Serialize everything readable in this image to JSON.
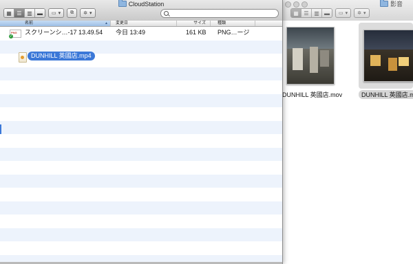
{
  "left_window": {
    "title": "CloudStation",
    "search": {
      "value": "",
      "placeholder": ""
    },
    "columns": {
      "name": "名前",
      "date": "変更日",
      "size": "サイズ",
      "kind": "種類"
    },
    "files": [
      {
        "name": "スクリーンシ…‐17 13.49.54",
        "date": "今日 13:49",
        "size": "161 KB",
        "kind": "PNG…ージ",
        "icon": "png-file-icon",
        "sync_status": "synced"
      },
      {
        "name": "DUNHILL 英國店.mp4",
        "date": "",
        "size": "",
        "kind": "",
        "icon": "mp4-file-icon",
        "selected": true
      }
    ]
  },
  "right_window": {
    "title": "影音",
    "items": [
      {
        "caption": "DUNHILL 英國店.mov",
        "caption_visible": "DUNHILL 英國店.mov"
      },
      {
        "caption": "DUNHILL 英國店.m",
        "selected": true
      }
    ]
  },
  "colors": {
    "selection": "#3b78d8",
    "stripe": "#edf3fc",
    "sync_badge": "#2e9b3c"
  }
}
